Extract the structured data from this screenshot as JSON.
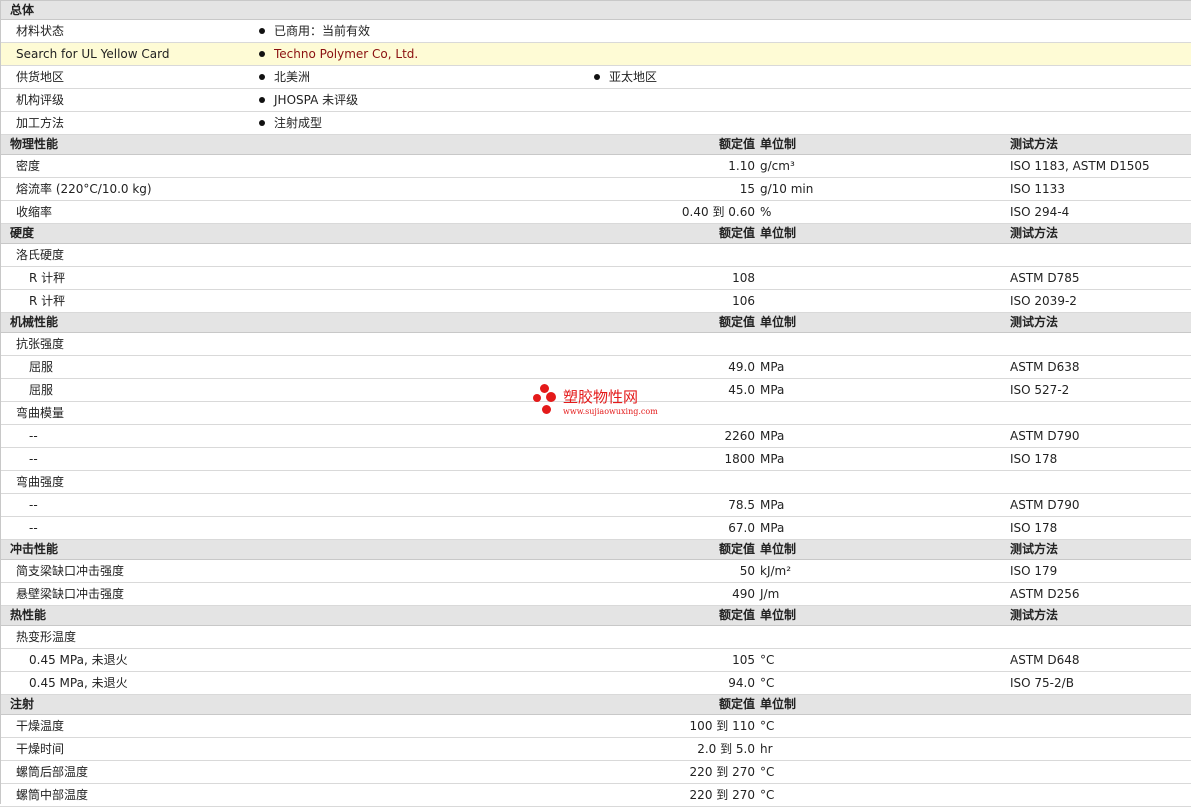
{
  "general": {
    "title": "总体",
    "rows": [
      {
        "label": "材料状态",
        "values": [
          "已商用：当前有效"
        ]
      },
      {
        "label": "Search for UL Yellow Card",
        "values": [
          "Techno Polymer Co, Ltd."
        ]
      },
      {
        "label": "供货地区",
        "values": [
          "北美洲",
          "亚太地区"
        ]
      },
      {
        "label": "机构评级",
        "values": [
          "JHOSPA 未评级"
        ]
      },
      {
        "label": "加工方法",
        "values": [
          "注射成型"
        ]
      }
    ]
  },
  "columns": {
    "nominal": "额定值",
    "unit": "单位制",
    "test": "测试方法"
  },
  "sections": [
    {
      "title": "物理性能",
      "rows": [
        {
          "label": "密度",
          "nominal": "1.10",
          "unit": "g/cm³",
          "test": "ISO 1183, ASTM D1505"
        },
        {
          "label": "熔流率  (220°C/10.0 kg)",
          "nominal": "15",
          "unit": "g/10 min",
          "test": "ISO 1133"
        },
        {
          "label": "收缩率",
          "nominal": "0.40 到  0.60",
          "unit": "%",
          "test": "ISO 294-4"
        }
      ]
    },
    {
      "title": "硬度",
      "rows": [
        {
          "label": "洛氏硬度"
        },
        {
          "label": "R 计秤",
          "sub": true,
          "nominal": "108",
          "test": "ASTM D785"
        },
        {
          "label": "R 计秤",
          "sub": true,
          "nominal": "106",
          "test": "ISO 2039-2"
        }
      ]
    },
    {
      "title": "机械性能",
      "rows": [
        {
          "label": "抗张强度"
        },
        {
          "label": "屈服",
          "sub": true,
          "nominal": "49.0",
          "unit": "MPa",
          "test": "ASTM D638"
        },
        {
          "label": "屈服",
          "sub": true,
          "nominal": "45.0",
          "unit": "MPa",
          "test": "ISO 527-2"
        },
        {
          "label": "弯曲模量"
        },
        {
          "label": "--",
          "sub": true,
          "nominal": "2260",
          "unit": "MPa",
          "test": "ASTM D790"
        },
        {
          "label": "--",
          "sub": true,
          "nominal": "1800",
          "unit": "MPa",
          "test": "ISO 178"
        },
        {
          "label": "弯曲强度"
        },
        {
          "label": "--",
          "sub": true,
          "nominal": "78.5",
          "unit": "MPa",
          "test": "ASTM D790"
        },
        {
          "label": "--",
          "sub": true,
          "nominal": "67.0",
          "unit": "MPa",
          "test": "ISO 178"
        }
      ]
    },
    {
      "title": "冲击性能",
      "rows": [
        {
          "label": "简支梁缺口冲击强度",
          "nominal": "50",
          "unit": "kJ/m²",
          "test": "ISO 179"
        },
        {
          "label": "悬壁梁缺口冲击强度",
          "nominal": "490",
          "unit": "J/m",
          "test": "ASTM D256"
        }
      ]
    },
    {
      "title": "热性能",
      "rows": [
        {
          "label": "热变形温度"
        },
        {
          "label": "0.45 MPa, 未退火",
          "sub": true,
          "nominal": "105",
          "unit": "°C",
          "test": "ASTM D648"
        },
        {
          "label": "0.45 MPa, 未退火",
          "sub": true,
          "nominal": "94.0",
          "unit": "°C",
          "test": "ISO 75-2/B"
        }
      ]
    },
    {
      "title": "注射",
      "no_test": true,
      "rows": [
        {
          "label": "干燥温度",
          "nominal": "100 到  110",
          "unit": "°C"
        },
        {
          "label": "干燥时间",
          "nominal": "2.0 到  5.0",
          "unit": "hr"
        },
        {
          "label": "螺筒后部温度",
          "nominal": "220 到  270",
          "unit": "°C"
        },
        {
          "label": "螺筒中部温度",
          "nominal": "220 到  270",
          "unit": "°C"
        }
      ]
    }
  ],
  "watermark": {
    "name": "塑胶物性网",
    "url": "www.sujiaowuxing.com",
    "color": "#e41a1a"
  }
}
